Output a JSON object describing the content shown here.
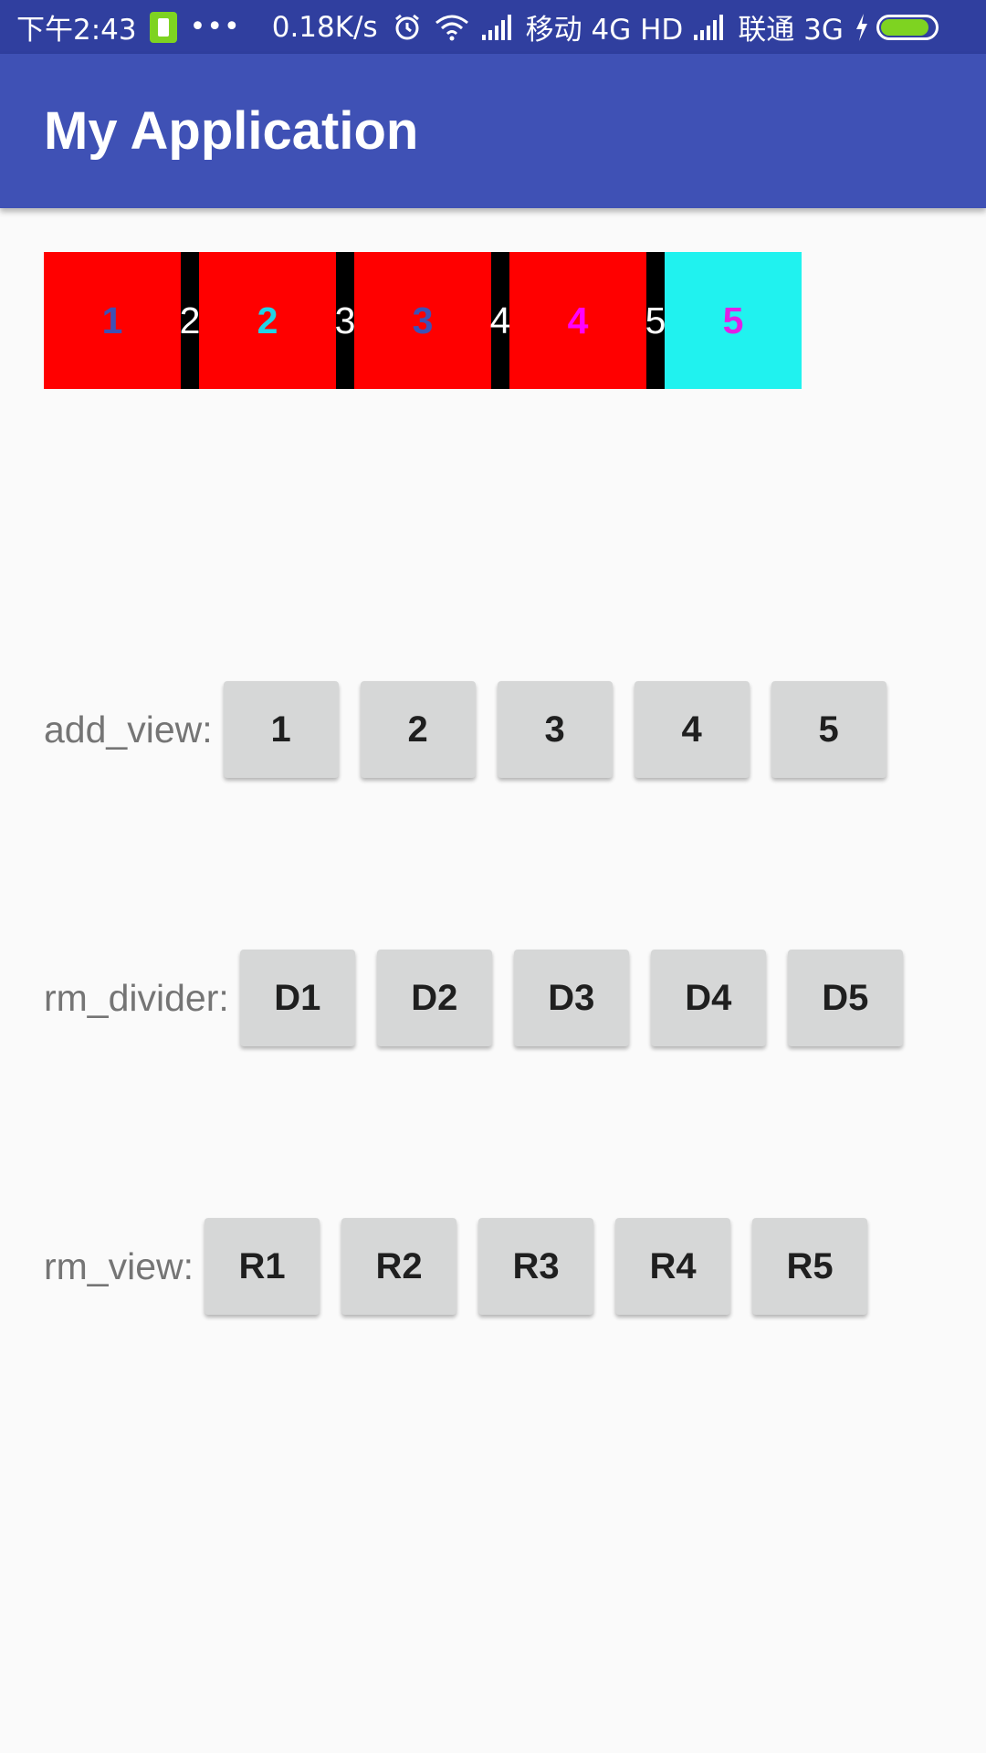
{
  "status_bar": {
    "time": "下午2:43",
    "more": "•••",
    "speed": "0.18K/s",
    "carrier1": "移动 4G HD",
    "carrier2": "联通 3G",
    "icons": [
      "sim-badge-icon",
      "alarm-icon",
      "wifi-icon",
      "signal-icon",
      "signal-icon",
      "charging-icon",
      "battery-icon"
    ],
    "battery_level": 0.9,
    "battery_color": "#7ed321"
  },
  "app_bar": {
    "title": "My Application",
    "color": "#3f51b5"
  },
  "tab_strip": {
    "tabs": [
      {
        "label": "1",
        "bg": "#ff0000",
        "fg": "#3f51b5"
      },
      {
        "label": "2",
        "bg": "#ff0000",
        "fg": "#21d4e6"
      },
      {
        "label": "3",
        "bg": "#ff0000",
        "fg": "#3f51b5"
      },
      {
        "label": "4",
        "bg": "#ff0000",
        "fg": "#ff00ff"
      },
      {
        "label": "5",
        "bg": "#20f2ef",
        "fg": "#e020e6"
      }
    ],
    "dividers": [
      "2",
      "3",
      "4",
      "5"
    ]
  },
  "rows": {
    "add_view": {
      "label": "add_view:",
      "buttons": [
        "1",
        "2",
        "3",
        "4",
        "5"
      ]
    },
    "rm_divider": {
      "label": "rm_divider:",
      "buttons": [
        "D1",
        "D2",
        "D3",
        "D4",
        "D5"
      ]
    },
    "rm_view": {
      "label": "rm_view:",
      "buttons": [
        "R1",
        "R2",
        "R3",
        "R4",
        "R5"
      ]
    }
  }
}
